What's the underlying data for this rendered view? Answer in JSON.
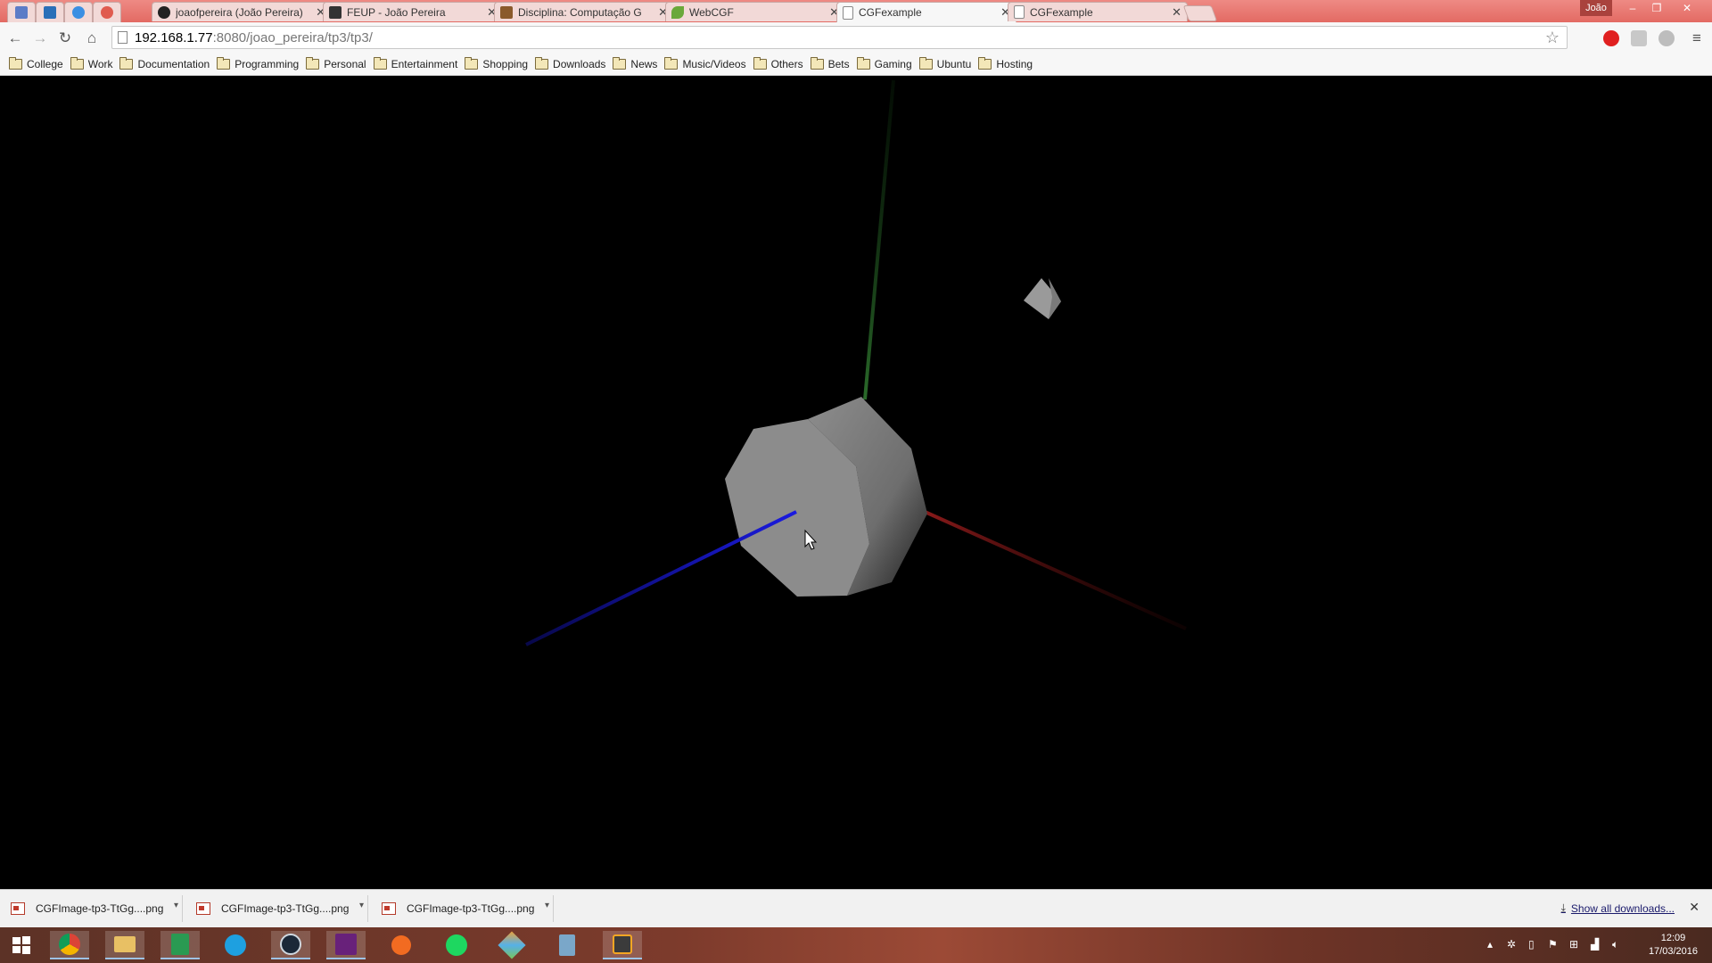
{
  "browser": {
    "pinned_tabs": [
      {
        "name": "gmail-icon",
        "color": "#5c7cc7"
      },
      {
        "name": "outlook-icon",
        "color": "#2a6fb8"
      },
      {
        "name": "messenger-icon",
        "color": "#3b8fe3"
      },
      {
        "name": "headphones-icon",
        "color": "#e05b4f"
      }
    ],
    "tabs": [
      {
        "title": "joaofpereira (João Pereira)",
        "icon": "github-icon",
        "color": "#222222",
        "active": false
      },
      {
        "title": "FEUP - João Pereira",
        "icon": "feup-icon",
        "color": "#333333",
        "active": false
      },
      {
        "title": "Disciplina: Computação G",
        "icon": "moodle-icon",
        "color": "#8a5a2b",
        "active": false
      },
      {
        "title": "WebCGF",
        "icon": "leaf-icon",
        "color": "#6aa83a",
        "active": false
      },
      {
        "title": "CGFexample",
        "icon": "page-icon",
        "color": "#888888",
        "active": true
      },
      {
        "title": "CGFexample",
        "icon": "page-icon",
        "color": "#888888",
        "active": false
      }
    ],
    "profile_name": "João",
    "url_host": "192.168.1.77",
    "url_rest": ":8080/joao_pereira/tp3/tp3/"
  },
  "bookmarks": [
    "College",
    "Work",
    "Documentation",
    "Programming",
    "Personal",
    "Entertainment",
    "Shopping",
    "Downloads",
    "News",
    "Music/Videos",
    "Others",
    "Bets",
    "Gaming",
    "Ubuntu",
    "Hosting"
  ],
  "scene": {
    "background": "#000000",
    "axis_colors": {
      "x": "#8a1a1a",
      "y": "#1f5a1f",
      "z": "#1a1ad0"
    },
    "object_color": "#8c8c8c"
  },
  "downloads": {
    "items": [
      "CGFImage-tp3-TtGg....png",
      "CGFImage-tp3-TtGg....png",
      "CGFImage-tp3-TtGg....png"
    ],
    "show_all": "Show all downloads..."
  },
  "taskbar": {
    "apps": [
      {
        "name": "chrome-icon",
        "color": "#e0c34b"
      },
      {
        "name": "file-explorer-icon",
        "color": "#e8c064"
      },
      {
        "name": "sheets-icon",
        "color": "#2a9a52"
      },
      {
        "name": "skype-icon",
        "color": "#1ea0e0"
      },
      {
        "name": "steam-icon",
        "color": "#1b2838"
      },
      {
        "name": "visual-studio-icon",
        "color": "#68217a"
      },
      {
        "name": "origin-icon",
        "color": "#f26b21"
      },
      {
        "name": "spotify-icon",
        "color": "#1ed760"
      },
      {
        "name": "paint-icon",
        "color": "#e9a23b"
      },
      {
        "name": "calculator-icon",
        "color": "#7aa7c9"
      },
      {
        "name": "sublime-icon",
        "color": "#f5a623"
      }
    ],
    "time": "12:09",
    "date": "17/03/2016"
  }
}
